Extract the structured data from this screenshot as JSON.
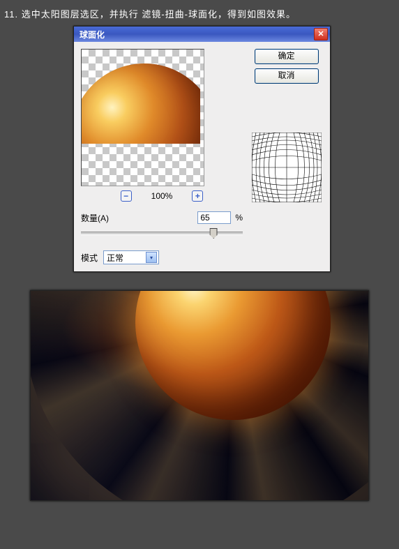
{
  "instruction_num": "11.",
  "instruction_text": "选中太阳图层选区，并执行  滤镜-扭曲-球面化，得到如图效果。",
  "dialog": {
    "title": "球面化",
    "ok_label": "确定",
    "cancel_label": "取消",
    "zoom_value": "100%",
    "amount_label": "数量(A)",
    "amount_value": "65",
    "amount_unit": "%",
    "mode_label": "模式",
    "mode_value": "正常"
  }
}
